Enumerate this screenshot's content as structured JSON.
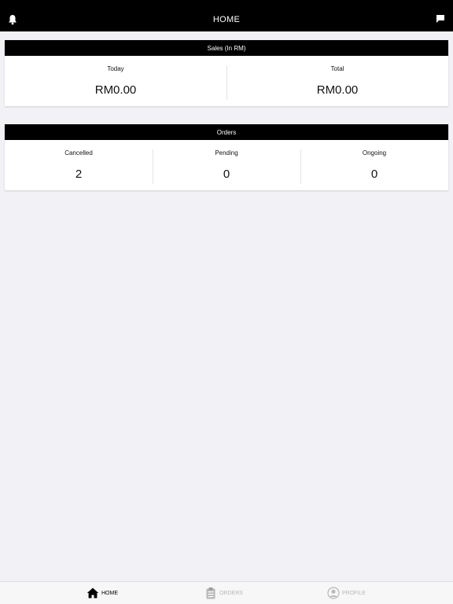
{
  "header": {
    "title": "HOME",
    "left_icon": "bell-icon",
    "right_icon": "chat-icon"
  },
  "sales": {
    "title": "Sales (In RM)",
    "today_label": "Today",
    "today_value": "RM0.00",
    "total_label": "Total",
    "total_value": "RM0.00"
  },
  "orders": {
    "title": "Orders",
    "cancelled_label": "Cancelled",
    "cancelled_value": "2",
    "pending_label": "Pending",
    "pending_value": "0",
    "ongoing_label": "Ongoing",
    "ongoing_value": "0"
  },
  "tabs": [
    {
      "label": "HOME",
      "icon": "home-icon",
      "active": true
    },
    {
      "label": "ORDERS",
      "icon": "clipboard-icon",
      "active": false
    },
    {
      "label": "PROFILE",
      "icon": "user-icon",
      "active": false
    }
  ],
  "colors": {
    "bar": "#000000",
    "background": "#f2f2f6",
    "inactive": "#b7b7b7"
  }
}
